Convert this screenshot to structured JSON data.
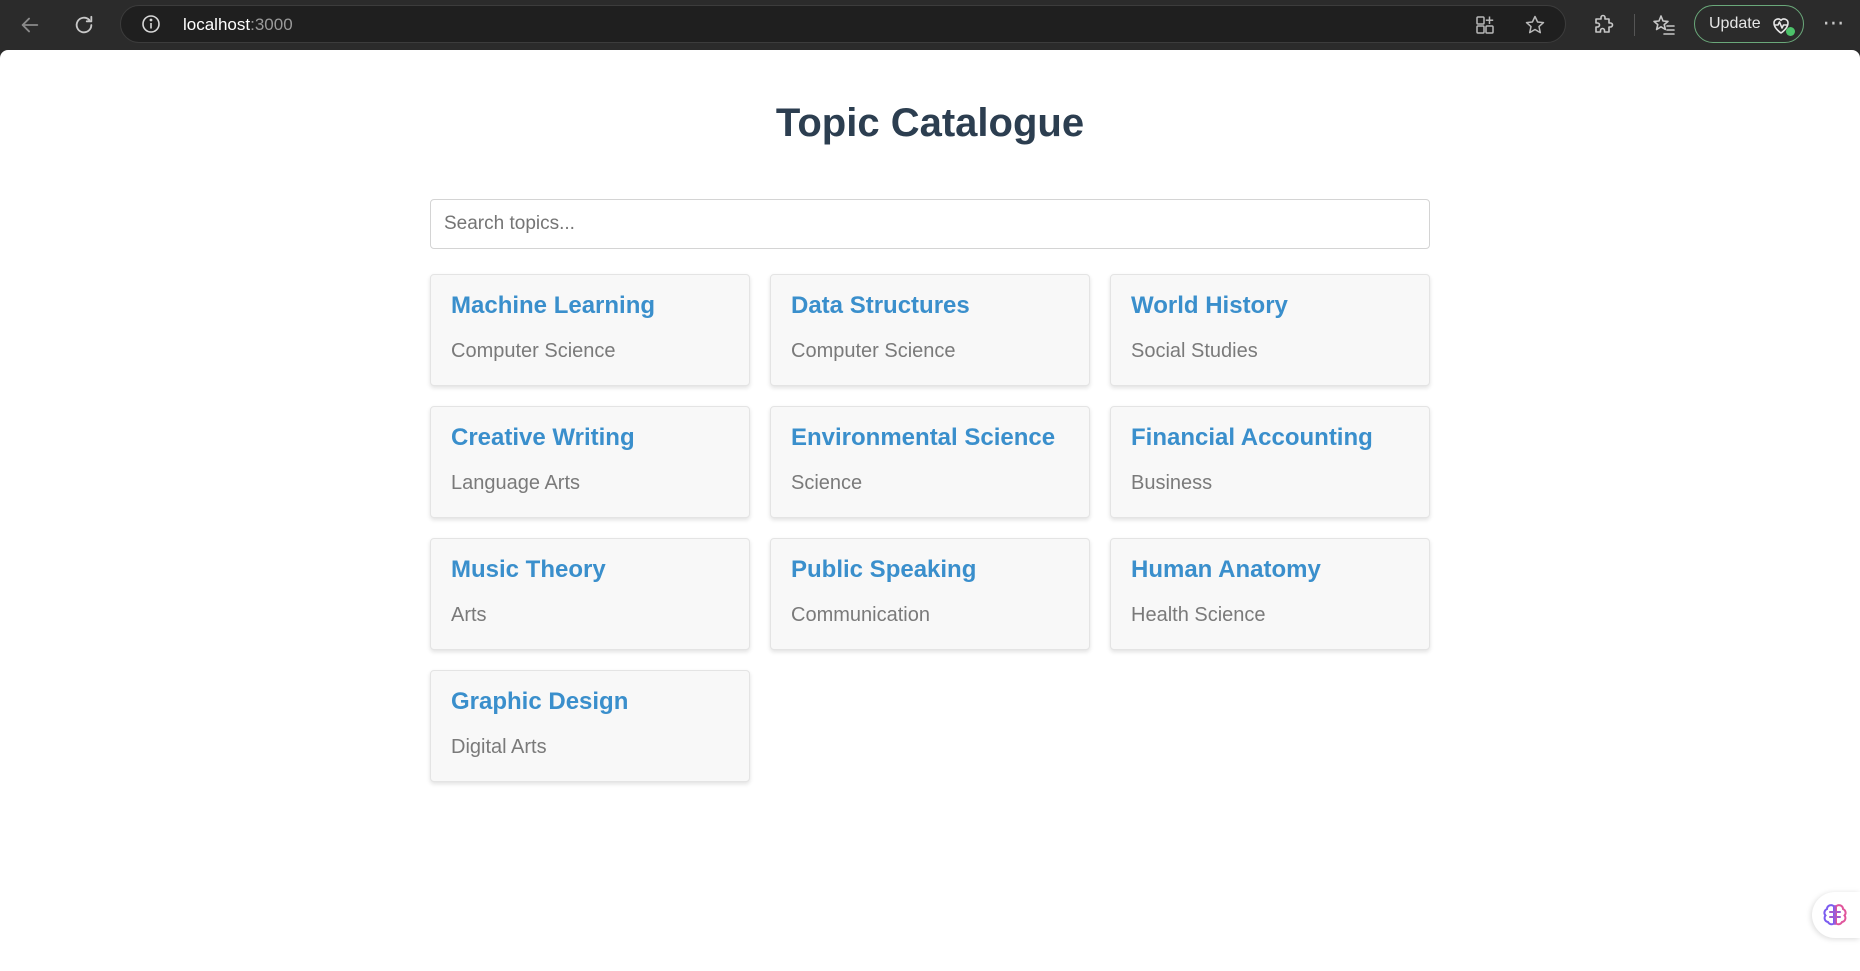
{
  "browser": {
    "url_host": "localhost",
    "url_port": ":3000",
    "update_label": "Update",
    "more_label": "⋯",
    "icons": {
      "back": "arrow-left-icon",
      "reload": "reload-icon",
      "info": "info-icon",
      "apps": "app-grid-icon",
      "favorite": "star-icon",
      "extensions": "puzzle-icon",
      "favorites": "favorites-list-icon",
      "update": "heart-pulse-icon",
      "more": "more-horizontal-icon"
    }
  },
  "page": {
    "title": "Topic Catalogue",
    "search": {
      "placeholder": "Search topics...",
      "value": ""
    },
    "topics": [
      {
        "title": "Machine Learning",
        "category": "Computer Science"
      },
      {
        "title": "Data Structures",
        "category": "Computer Science"
      },
      {
        "title": "World History",
        "category": "Social Studies"
      },
      {
        "title": "Creative Writing",
        "category": "Language Arts"
      },
      {
        "title": "Environmental Science",
        "category": "Science"
      },
      {
        "title": "Financial Accounting",
        "category": "Business"
      },
      {
        "title": "Music Theory",
        "category": "Arts"
      },
      {
        "title": "Public Speaking",
        "category": "Communication"
      },
      {
        "title": "Human Anatomy",
        "category": "Health Science"
      },
      {
        "title": "Graphic Design",
        "category": "Digital Arts"
      }
    ]
  },
  "colors": {
    "title": "#2c3e50",
    "card_title": "#3a8fcc",
    "card_category": "#7a7a7a",
    "card_bg": "#f8f8f8",
    "update_dot": "#4cc26a"
  }
}
